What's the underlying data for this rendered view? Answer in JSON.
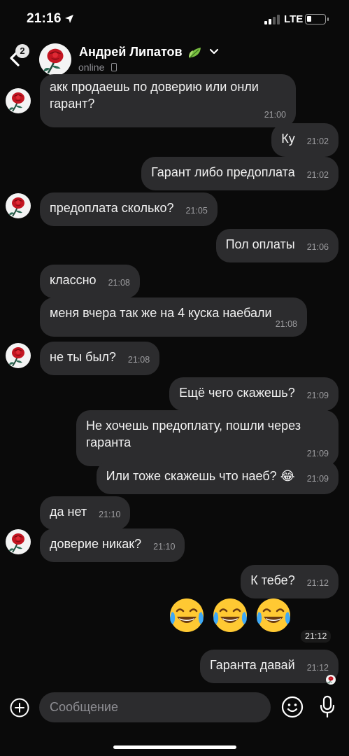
{
  "status_bar": {
    "time": "21:16",
    "network": "LTE"
  },
  "header": {
    "back_count": "2",
    "contact_name": "Андрей Липатов",
    "status": "online"
  },
  "messages": [
    {
      "side": "in",
      "text": "акк продаешь по доверию или онли гарант?",
      "time": "21:00"
    },
    {
      "side": "out",
      "text": "Ку",
      "time": "21:02"
    },
    {
      "side": "out",
      "text": "Гарант либо предоплата",
      "time": "21:02"
    },
    {
      "side": "in",
      "text": "предоплата сколько?",
      "time": "21:05"
    },
    {
      "side": "out",
      "text": "Пол оплаты",
      "time": "21:06"
    },
    {
      "side": "in",
      "text": "классно",
      "time": "21:08"
    },
    {
      "side": "in",
      "text": "меня вчера так же на 4 куска наебали",
      "time": "21:08"
    },
    {
      "side": "in",
      "text": "не ты был?",
      "time": "21:08"
    },
    {
      "side": "out",
      "text": "Ещё чего скажешь?",
      "time": "21:09"
    },
    {
      "side": "out",
      "text": "Не хочешь предоплату, пошли через гаранта",
      "time": "21:09"
    },
    {
      "side": "out",
      "text": "Или тоже скажешь что наеб? 😂",
      "time": "21:09"
    },
    {
      "side": "in",
      "text": "да нет",
      "time": "21:10"
    },
    {
      "side": "in",
      "text": "доверие никак?",
      "time": "21:10"
    },
    {
      "side": "out",
      "text": "К тебе?",
      "time": "21:12"
    },
    {
      "side": "out",
      "text": "😂😂😂",
      "time": "21:12",
      "emoji_only": true
    },
    {
      "side": "out",
      "text": "Гаранта давай",
      "time": "21:12"
    }
  ],
  "input": {
    "placeholder": "Сообщение"
  },
  "icons": {
    "back": "chevron-left-icon",
    "leaf": "leaf-icon",
    "add": "plus-circle-icon",
    "sticker": "smile-icon",
    "voice": "microphone-icon"
  },
  "colors": {
    "background": "#0a0a0a",
    "bubble": "#2c2c2e",
    "text": "#f2f2f2",
    "secondary": "#9c9c9f"
  }
}
